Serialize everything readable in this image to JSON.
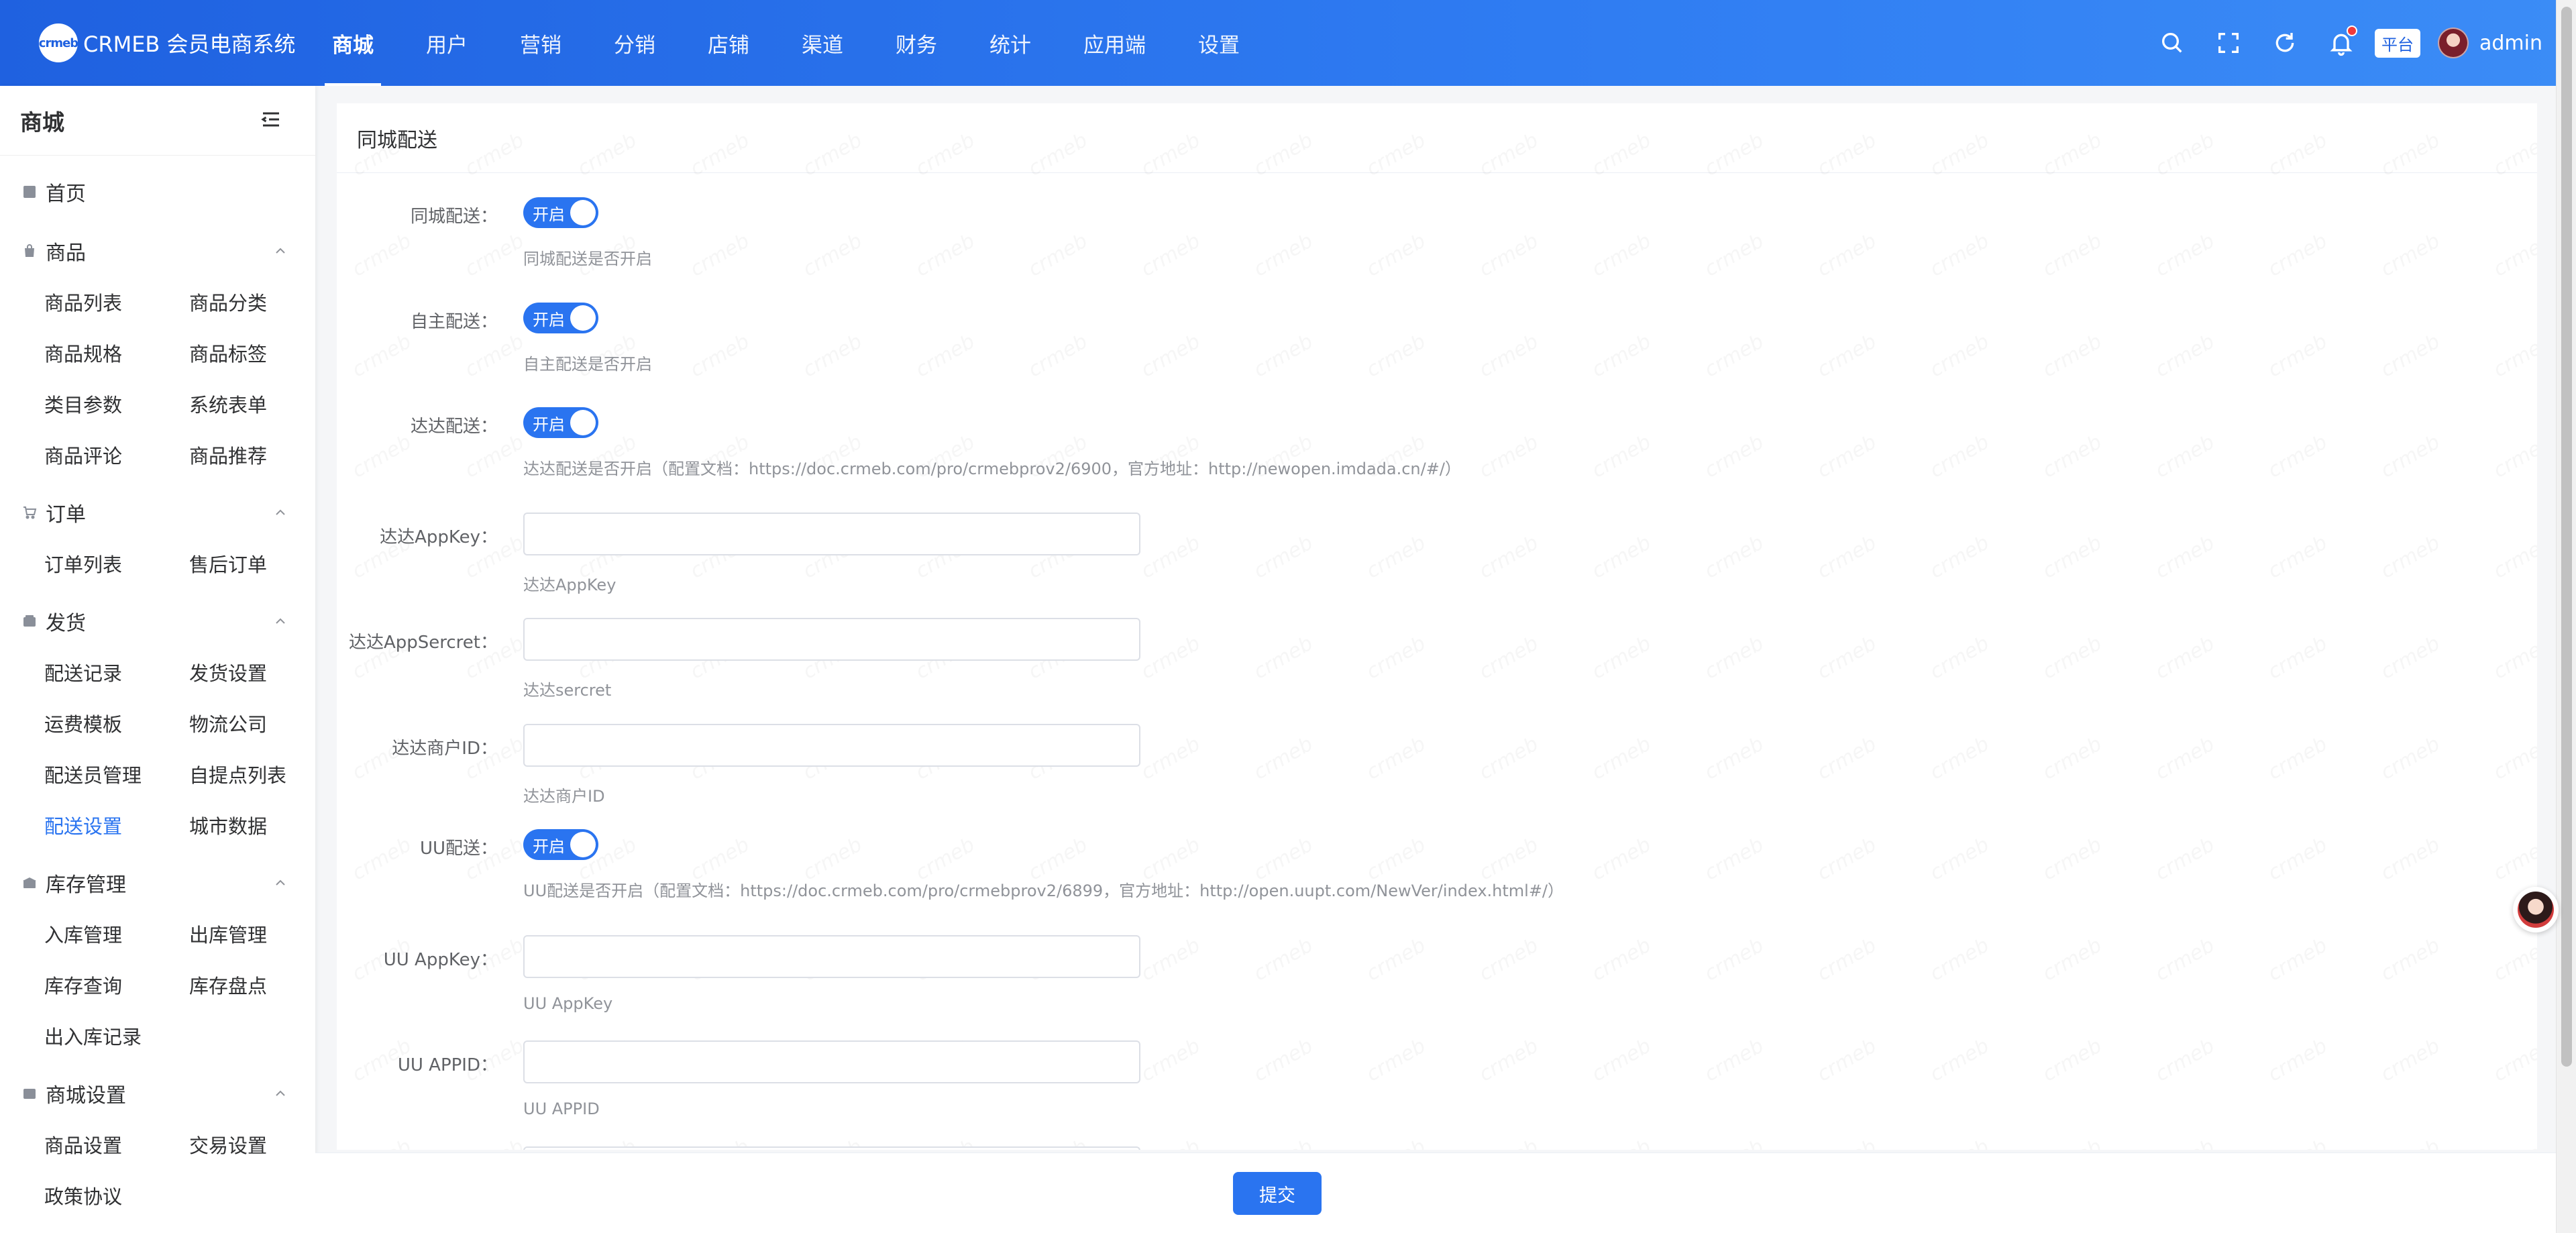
{
  "header": {
    "logo_mark": "crmeb",
    "logo_text": "CRMEB 会员电商系统",
    "nav": [
      "商城",
      "用户",
      "营销",
      "分销",
      "店铺",
      "渠道",
      "财务",
      "统计",
      "应用端",
      "设置"
    ],
    "active_nav": "商城",
    "platform_badge": "平台",
    "username": "admin",
    "icons": [
      "search-icon",
      "fullscreen-icon",
      "refresh-icon",
      "bell-icon"
    ]
  },
  "sidebar": {
    "title": "商城",
    "home": "首页",
    "groups": [
      {
        "label": "商品",
        "items": [
          "商品列表",
          "商品分类",
          "商品规格",
          "商品标签",
          "类目参数",
          "系统表单",
          "商品评论",
          "商品推荐"
        ]
      },
      {
        "label": "订单",
        "items": [
          "订单列表",
          "售后订单"
        ]
      },
      {
        "label": "发货",
        "items": [
          "配送记录",
          "发货设置",
          "运费模板",
          "物流公司",
          "配送员管理",
          "自提点列表",
          "配送设置",
          "城市数据"
        ]
      },
      {
        "label": "库存管理",
        "items": [
          "入库管理",
          "出库管理",
          "库存查询",
          "库存盘点",
          "出入库记录"
        ]
      },
      {
        "label": "商城设置",
        "items": [
          "商品设置",
          "交易设置",
          "政策协议"
        ]
      }
    ],
    "active_item": "配送设置"
  },
  "main": {
    "card_title": "同城配送",
    "switch_on_text": "开启",
    "watermark": "crmeb",
    "fields": {
      "city": {
        "label": "同城配送：",
        "tip": "同城配送是否开启"
      },
      "self": {
        "label": "自主配送：",
        "tip": "自主配送是否开启"
      },
      "dada": {
        "label": "达达配送：",
        "tip": "达达配送是否开启（配置文档：https://doc.crmeb.com/pro/crmebprov2/6900，官方地址：http://newopen.imdada.cn/#/）"
      },
      "dada_appkey": {
        "label": "达达AppKey：",
        "tip": "达达AppKey",
        "value": ""
      },
      "dada_secret": {
        "label": "达达AppSercret：",
        "tip": "达达sercret",
        "value": ""
      },
      "dada_merchant": {
        "label": "达达商户ID：",
        "tip": "达达商户ID",
        "value": ""
      },
      "uu": {
        "label": "UU配送：",
        "tip": "UU配送是否开启（配置文档：https://doc.crmeb.com/pro/crmebprov2/6899，官方地址：http://open.uupt.com/NewVer/index.html#/）"
      },
      "uu_appkey": {
        "label": "UU AppKey：",
        "tip": "UU AppKey",
        "value": ""
      },
      "uu_appid": {
        "label": "UU APPID：",
        "tip": "UU APPID",
        "value": ""
      }
    }
  },
  "footer": {
    "submit_label": "提交"
  }
}
